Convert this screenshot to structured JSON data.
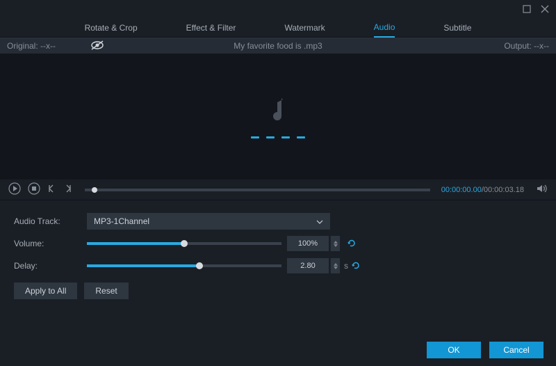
{
  "tabs": {
    "rotate": "Rotate & Crop",
    "effect": "Effect & Filter",
    "watermark": "Watermark",
    "audio": "Audio",
    "subtitle": "Subtitle"
  },
  "infobar": {
    "original": "Original: --x--",
    "filename": "My favorite food is .mp3",
    "output": "Output: --x--"
  },
  "timecode": {
    "current": "00:00:00.00",
    "total": "/00:00:03.18"
  },
  "panel": {
    "audio_track_label": "Audio Track:",
    "audio_track_value": "MP3-1Channel",
    "volume_label": "Volume:",
    "volume_value": "100%",
    "delay_label": "Delay:",
    "delay_value": "2.80",
    "delay_unit": "s"
  },
  "buttons": {
    "apply_all": "Apply to All",
    "reset": "Reset",
    "ok": "OK",
    "cancel": "Cancel"
  },
  "slider": {
    "volume_fill": "50%",
    "volume_knob": "50%",
    "delay_fill": "58%",
    "delay_knob": "58%"
  }
}
